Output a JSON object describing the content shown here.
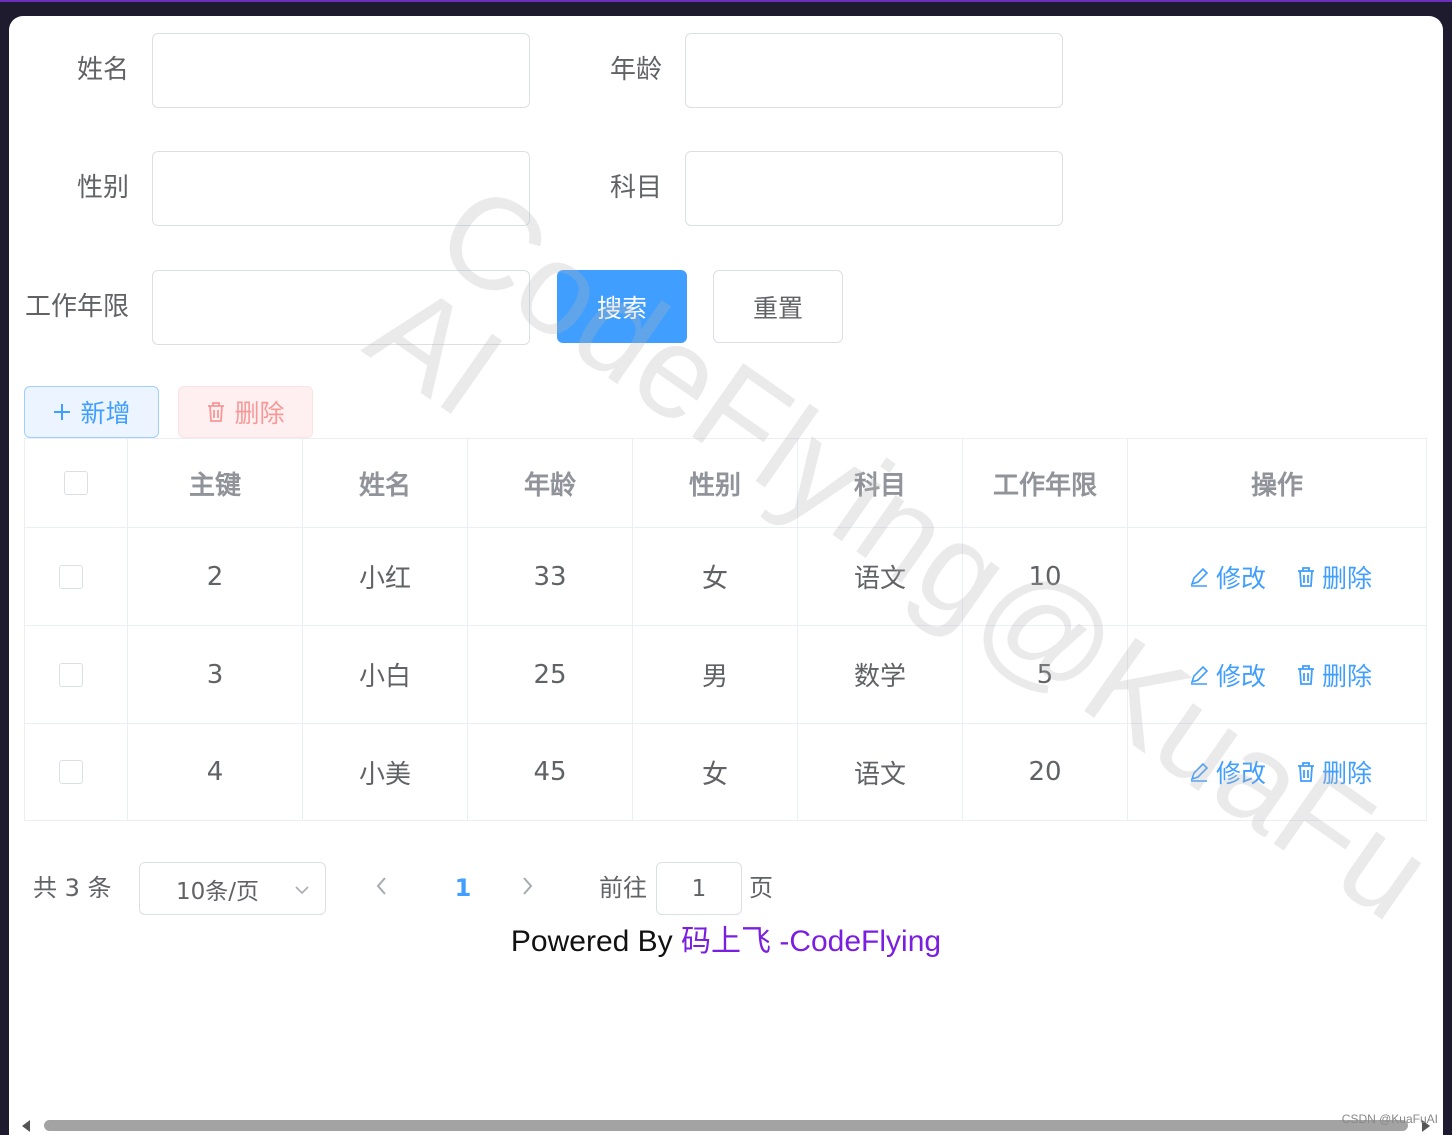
{
  "form": {
    "name_label": "姓名",
    "age_label": "年龄",
    "gender_label": "性别",
    "subject_label": "科目",
    "years_label": "工作年限",
    "search_label": "搜索",
    "reset_label": "重置"
  },
  "toolbar": {
    "add_label": "新增",
    "delete_label": "删除"
  },
  "table": {
    "headers": [
      "主键",
      "姓名",
      "年龄",
      "性别",
      "科目",
      "工作年限",
      "操作"
    ],
    "rows": [
      {
        "id": "2",
        "name": "小红",
        "age": "33",
        "gender": "女",
        "subject": "语文",
        "years": "10"
      },
      {
        "id": "3",
        "name": "小白",
        "age": "25",
        "gender": "男",
        "subject": "数学",
        "years": "5"
      },
      {
        "id": "4",
        "name": "小美",
        "age": "45",
        "gender": "女",
        "subject": "语文",
        "years": "20"
      }
    ],
    "edit_label": "修改",
    "row_delete_label": "删除"
  },
  "pagination": {
    "total_text": "共 3 条",
    "page_size": "10条/页",
    "current_page": "1",
    "goto_label": "前往",
    "goto_value": "1",
    "page_suffix": "页"
  },
  "footer": {
    "prefix": "Powered By",
    "link": "码上飞 -CodeFlying"
  },
  "watermark": {
    "line1": "CodeFlying@KuaFu",
    "line2": "AI"
  },
  "credit": "CSDN @KuaFuAI"
}
